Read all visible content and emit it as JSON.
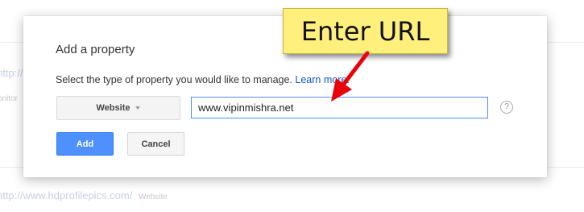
{
  "background": {
    "url_partial": "http://",
    "monitor_partial": "onitor",
    "site_url": "http://www.hdprofilepics.com/",
    "site_type": "Website"
  },
  "dialog": {
    "title": "Add a property",
    "description": "Select the type of property you would like to manage.",
    "learn_more": "Learn more.",
    "type_select": "Website",
    "url_value": "www.vipinmishra.net",
    "help": "?",
    "add_label": "Add",
    "cancel_label": "Cancel",
    "primary_color": "#4d90fe"
  },
  "annotation": {
    "label": "Enter URL",
    "callout_color": "#ffef7d",
    "arrow_color": "#e8000b"
  },
  "icons": {
    "dropdown": "caret-down-icon",
    "help": "help-circle-icon",
    "annotation_arrow": "red-arrow-icon"
  }
}
